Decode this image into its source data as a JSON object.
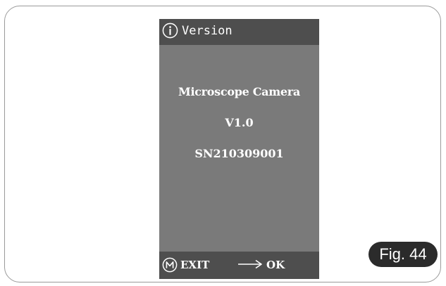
{
  "screen": {
    "header": {
      "title": "Version",
      "icon": "info-icon"
    },
    "content": {
      "product_name": "Microscope Camera",
      "version": "V1.0",
      "serial_number": "SN210309001"
    },
    "footer": {
      "exit_icon": "m-button-icon",
      "exit_label": "EXIT",
      "ok_icon": "right-arrow-icon",
      "ok_label": "OK"
    }
  },
  "figure_label": "Fig. 44",
  "colors": {
    "screen_background": "#7a7a7a",
    "bar_background": "#4e4e4e",
    "text": "#ffffff",
    "badge_background": "#2b2b2b"
  }
}
